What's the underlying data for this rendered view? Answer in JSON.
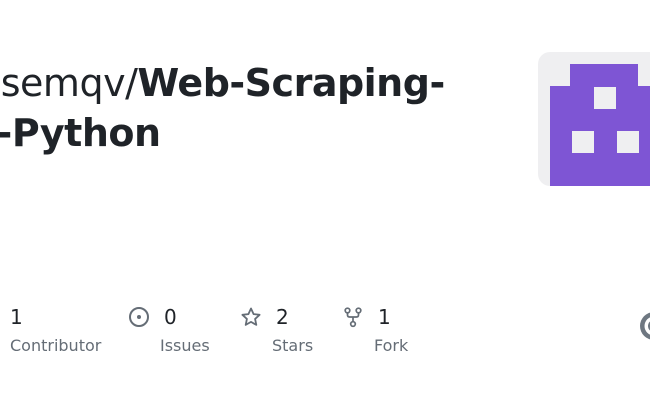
{
  "repo": {
    "owner": "osemqv",
    "separator": "/",
    "name_part1": "Web-Scraping-",
    "name_part2": "n-Python"
  },
  "avatar": {
    "icon": "identicon",
    "color": "#7e55d4",
    "background": "#efeff1"
  },
  "stats": {
    "contributors": {
      "value": "1",
      "label": "Contributor",
      "icon": "people-icon"
    },
    "issues": {
      "value": "0",
      "label": "Issues",
      "icon": "issue-opened-icon"
    },
    "stars": {
      "value": "2",
      "label": "Stars",
      "icon": "star-icon"
    },
    "forks": {
      "value": "1",
      "label": "Fork",
      "icon": "repo-forked-icon"
    }
  },
  "colors": {
    "text": "#1f2328",
    "muted": "#656d76",
    "icon": "#656d76"
  }
}
